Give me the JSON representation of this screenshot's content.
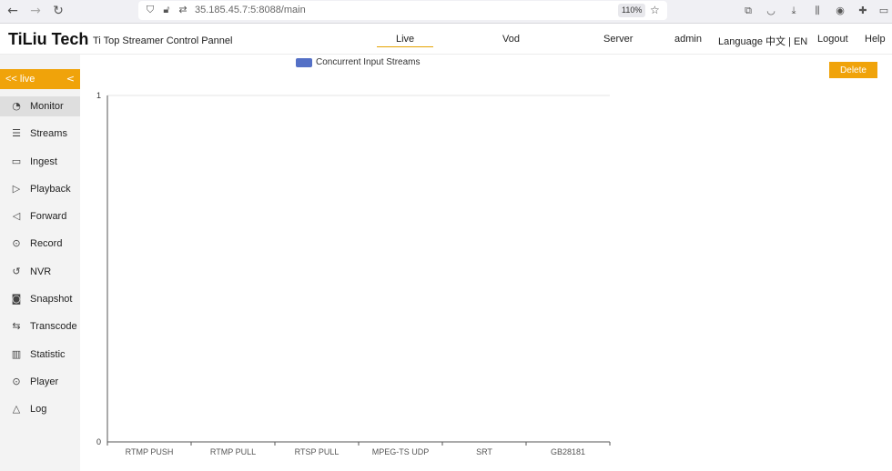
{
  "browser": {
    "url": "35.185.45.7:5:8088/main",
    "zoom": "110%"
  },
  "header": {
    "brand": "TiLiu Tech",
    "subtitle": "Ti Top Streamer Control Pannel",
    "nav": {
      "live": "Live",
      "vod": "Vod",
      "server": "Server",
      "user": "admin",
      "language": "Language 中文 | EN",
      "logout": "Logout",
      "help": "Help"
    }
  },
  "sidebar": {
    "header_label": "<< live",
    "collapse_glyph": "<",
    "items": [
      {
        "label": "Monitor",
        "icon": "dashboard-icon"
      },
      {
        "label": "Streams",
        "icon": "list-icon"
      },
      {
        "label": "Ingest",
        "icon": "video-camera-icon"
      },
      {
        "label": "Playback",
        "icon": "play-icon"
      },
      {
        "label": "Forward",
        "icon": "send-icon"
      },
      {
        "label": "Record",
        "icon": "record-icon"
      },
      {
        "label": "NVR",
        "icon": "history-icon"
      },
      {
        "label": "Snapshot",
        "icon": "camera-icon"
      },
      {
        "label": "Transcode",
        "icon": "swap-icon"
      },
      {
        "label": "Statistic",
        "icon": "bar-chart-icon"
      },
      {
        "label": "Player",
        "icon": "play-circle-icon"
      },
      {
        "label": "Log",
        "icon": "warning-icon"
      }
    ]
  },
  "main": {
    "delete_label": "Delete"
  },
  "chart_data": {
    "type": "bar",
    "categories": [
      "RTMP PUSH",
      "RTMP PULL",
      "RTSP PULL",
      "MPEG-TS UDP",
      "SRT",
      "GB28181"
    ],
    "series": [
      {
        "name": "Concurrent Input Streams",
        "values": [
          0,
          0,
          0,
          0,
          0,
          0
        ],
        "color": "#5470c6"
      }
    ],
    "ylim": [
      0,
      1
    ],
    "yticks": [
      0,
      1
    ],
    "legend_position": "top-center",
    "grid": true
  }
}
